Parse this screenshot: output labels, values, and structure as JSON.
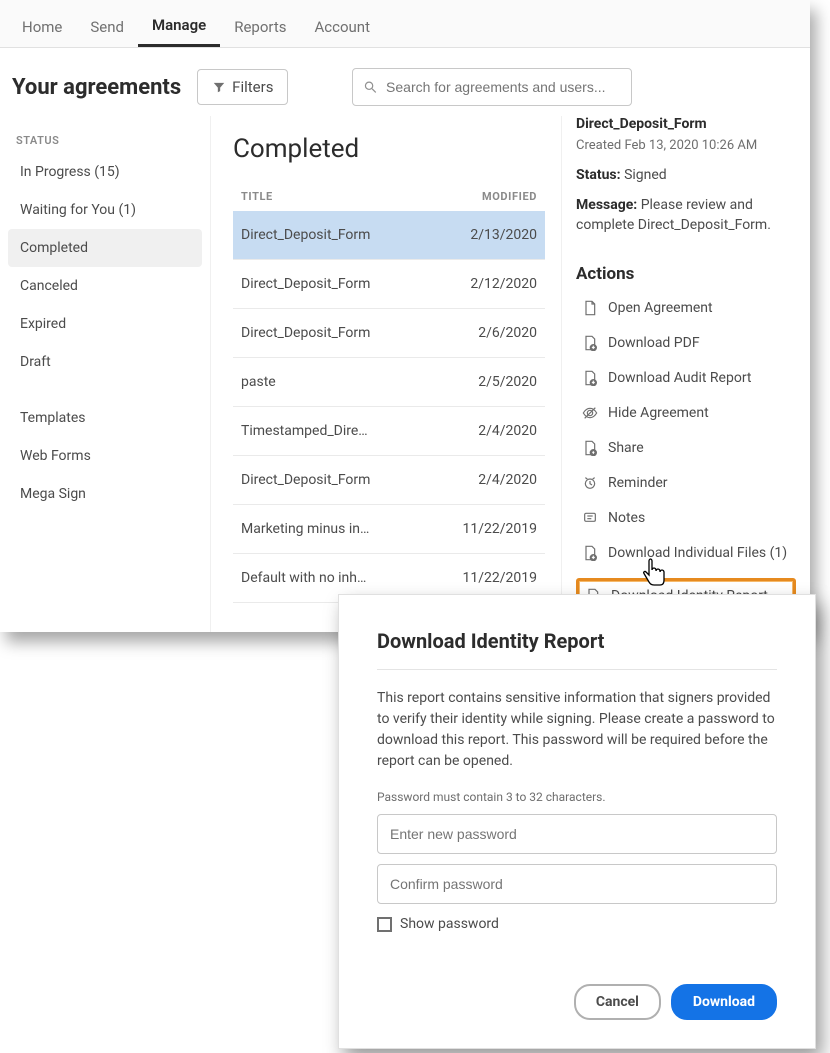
{
  "nav": {
    "tabs": [
      {
        "label": "Home",
        "active": false
      },
      {
        "label": "Send",
        "active": false
      },
      {
        "label": "Manage",
        "active": true
      },
      {
        "label": "Reports",
        "active": false
      },
      {
        "label": "Account",
        "active": false
      }
    ]
  },
  "header": {
    "page_title": "Your agreements",
    "filters_label": "Filters",
    "search_placeholder": "Search for agreements and users..."
  },
  "sidebar": {
    "status_label": "STATUS",
    "status_items": [
      {
        "label": "In Progress (15)",
        "active": false
      },
      {
        "label": "Waiting for You (1)",
        "active": false
      },
      {
        "label": "Completed",
        "active": true
      },
      {
        "label": "Canceled",
        "active": false
      },
      {
        "label": "Expired",
        "active": false
      },
      {
        "label": "Draft",
        "active": false
      }
    ],
    "other_items": [
      {
        "label": "Templates"
      },
      {
        "label": "Web Forms"
      },
      {
        "label": "Mega Sign"
      }
    ]
  },
  "center": {
    "heading": "Completed",
    "col_title": "TITLE",
    "col_modified": "MODIFIED",
    "rows": [
      {
        "title": "Direct_Deposit_Form",
        "modified": "2/13/2020",
        "selected": true
      },
      {
        "title": "Direct_Deposit_Form",
        "modified": "2/12/2020",
        "selected": false
      },
      {
        "title": "Direct_Deposit_Form",
        "modified": "2/6/2020",
        "selected": false
      },
      {
        "title": "paste",
        "modified": "2/5/2020",
        "selected": false
      },
      {
        "title": "Timestamped_Dire…",
        "modified": "2/4/2020",
        "selected": false
      },
      {
        "title": "Direct_Deposit_Form",
        "modified": "2/4/2020",
        "selected": false
      },
      {
        "title": "Marketing minus in…",
        "modified": "11/22/2019",
        "selected": false
      },
      {
        "title": "Default with no inh…",
        "modified": "11/22/2019",
        "selected": false
      }
    ]
  },
  "right": {
    "doc_title": "Direct_Deposit_Form",
    "created_label": "Created",
    "created_value": "Feb 13, 2020 10:26 AM",
    "status_label": "Status:",
    "status_value": "Signed",
    "message_label": "Message:",
    "message_value": "Please review and complete Direct_Deposit_Form.",
    "actions_heading": "Actions",
    "actions": [
      {
        "icon": "file-icon",
        "label": "Open Agreement"
      },
      {
        "icon": "download-pdf-icon",
        "label": "Download PDF"
      },
      {
        "icon": "download-audit-icon",
        "label": "Download Audit Report"
      },
      {
        "icon": "hide-icon",
        "label": "Hide Agreement"
      },
      {
        "icon": "share-icon",
        "label": "Share"
      },
      {
        "icon": "reminder-icon",
        "label": "Reminder"
      },
      {
        "icon": "notes-icon",
        "label": "Notes"
      },
      {
        "icon": "download-files-icon",
        "label": "Download Individual Files (1)"
      },
      {
        "icon": "download-identity-icon",
        "label": "Download Identity Report",
        "highlight": true
      }
    ]
  },
  "modal": {
    "title": "Download Identity Report",
    "description": "This report contains sensitive information that signers provided to verify their identity while signing. Please create a password to download this report. This password will be required before the report can be opened.",
    "hint": "Password must contain 3 to 32 characters.",
    "new_pw_placeholder": "Enter new password",
    "confirm_pw_placeholder": "Confirm password",
    "show_pw_label": "Show password",
    "cancel_label": "Cancel",
    "download_label": "Download"
  }
}
